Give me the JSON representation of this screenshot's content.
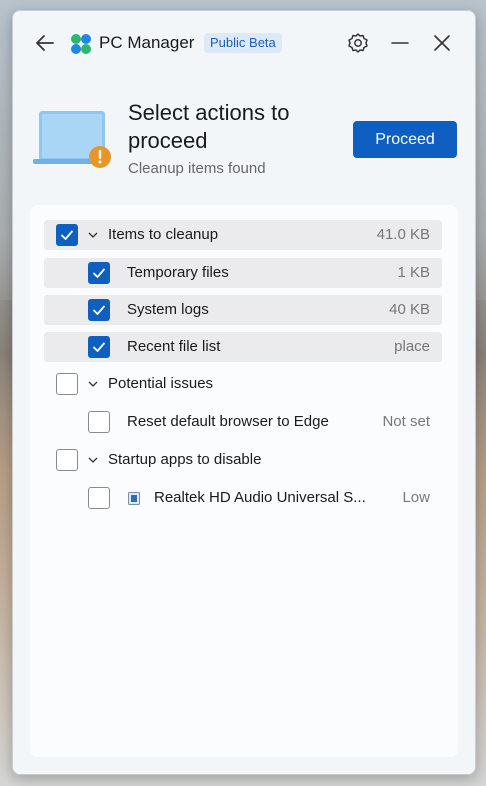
{
  "app": {
    "name": "PC Manager",
    "badge": "Public Beta"
  },
  "hero": {
    "title": "Select actions to proceed",
    "subtitle": "Cleanup items found",
    "proceed_label": "Proceed"
  },
  "groups": [
    {
      "label": "Items to cleanup",
      "value": "41.0 KB",
      "checked": true,
      "items": [
        {
          "label": "Temporary files",
          "value": "1 KB",
          "checked": true
        },
        {
          "label": "System logs",
          "value": "40 KB",
          "checked": true
        },
        {
          "label": "Recent file list",
          "value": "place",
          "checked": true
        }
      ]
    },
    {
      "label": "Potential issues",
      "value": "",
      "checked": false,
      "items": [
        {
          "label": "Reset default browser to Edge",
          "value": "Not set",
          "checked": false
        }
      ]
    },
    {
      "label": "Startup apps to disable",
      "value": "",
      "checked": false,
      "items": [
        {
          "label": "Realtek HD Audio Universal S...",
          "value": "Low",
          "checked": false,
          "icon": "app-icon"
        }
      ]
    }
  ],
  "colors": {
    "accent": "#0f5fc0",
    "warning": "#e8962a"
  }
}
